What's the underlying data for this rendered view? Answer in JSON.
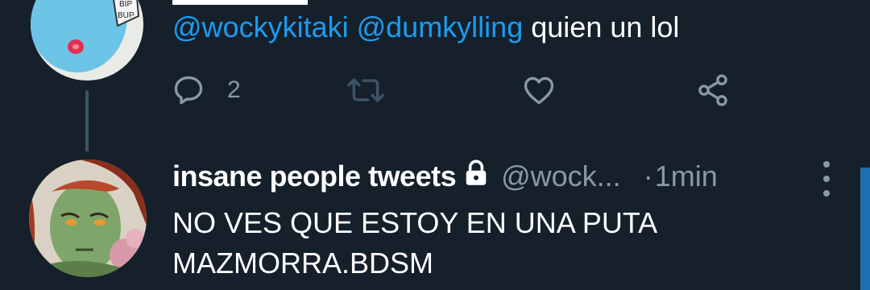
{
  "tweets": [
    {
      "mentions": [
        "@wockykitaki",
        "@dumkylling"
      ],
      "text": "quien un lol",
      "actions": {
        "reply_count": "2",
        "retweet_count": "",
        "like_count": ""
      },
      "avatar_lettering": "BIP BIP BUP"
    },
    {
      "display_name": "insane people tweets",
      "handle": "@wock...",
      "separator": "·",
      "timestamp": "1min",
      "text": "NO VES QUE ESTOY EN UNA PUTA MAZMORRA.BDSM"
    }
  ],
  "icons": {
    "reply": "reply-icon",
    "retweet": "retweet-icon",
    "like": "heart-icon",
    "share": "share-icon",
    "lock": "lock-icon",
    "more": "more-vertical-icon"
  },
  "colors": {
    "background": "#15202b",
    "mention": "#1d9bf0",
    "secondary_text": "#8b98a5",
    "thread_line": "#3d5466"
  }
}
